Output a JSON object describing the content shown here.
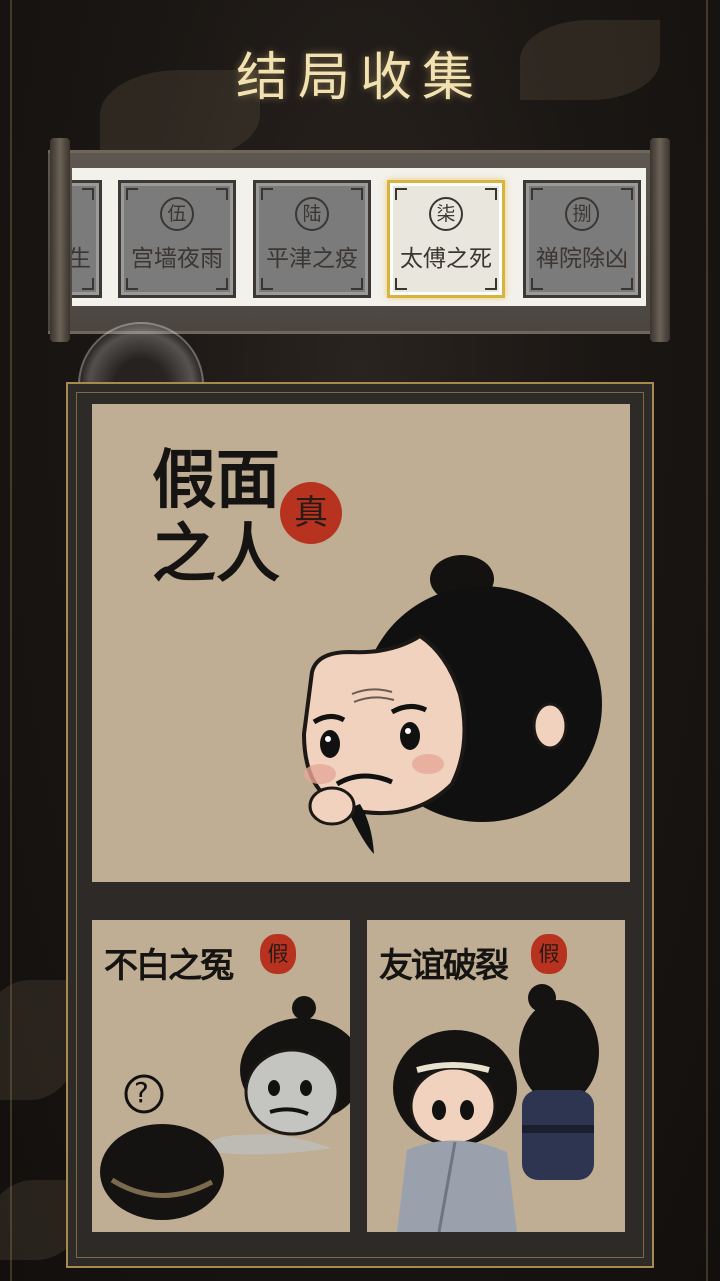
{
  "screen": {
    "title": "结局收集"
  },
  "ending_tabs": [
    {
      "numeral": "",
      "label": "生",
      "selected": false
    },
    {
      "numeral": "伍",
      "label": "宫墙夜雨",
      "selected": false
    },
    {
      "numeral": "陆",
      "label": "平津之疫",
      "selected": false
    },
    {
      "numeral": "柒",
      "label": "太傅之死",
      "selected": true
    },
    {
      "numeral": "捌",
      "label": "禅院除凶",
      "selected": false
    }
  ],
  "endings": {
    "main": {
      "title": "假面之人",
      "seal": "真"
    },
    "alt1": {
      "title": "不白之冤",
      "seal": "假"
    },
    "alt2": {
      "title": "友谊破裂",
      "seal": "假"
    }
  },
  "colors": {
    "accent_gold": "#d8b43e",
    "seal_red": "#b8331f",
    "paper": "#bfae93"
  }
}
